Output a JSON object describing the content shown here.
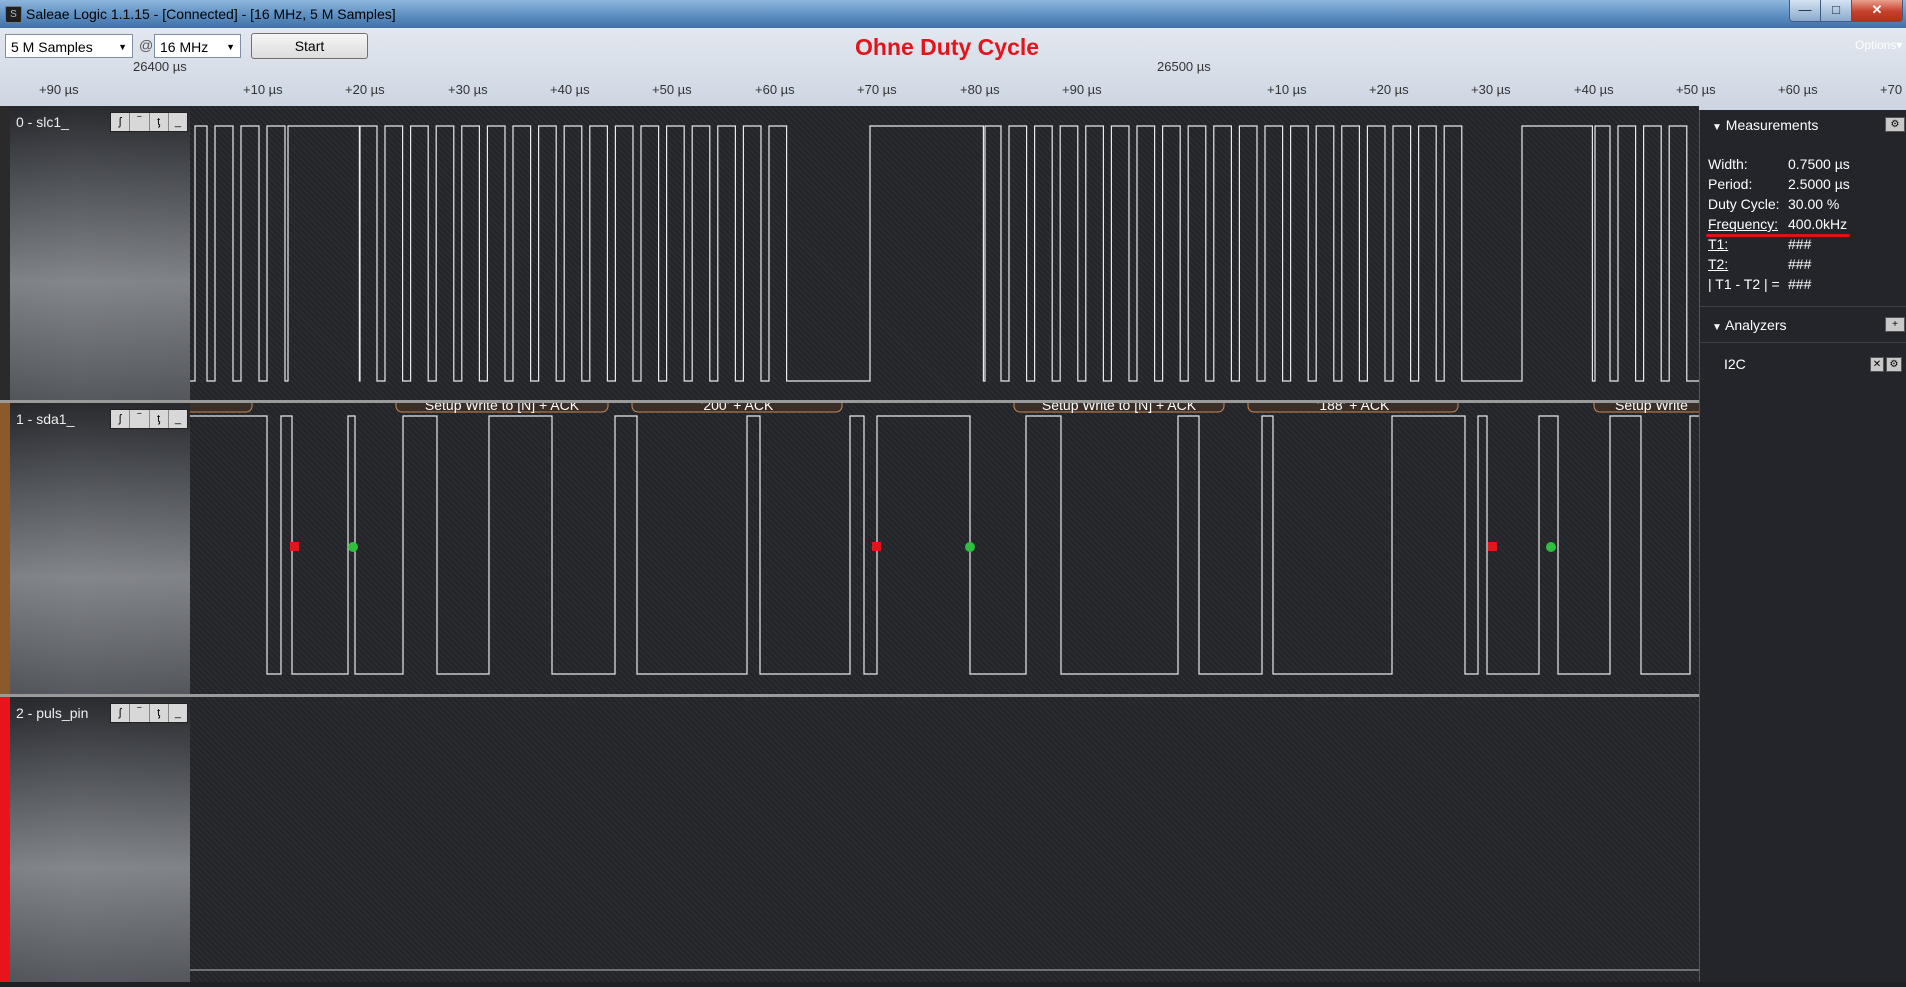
{
  "window": {
    "title": "Saleae Logic 1.1.15 - [Connected] - [16 MHz, 5 M Samples]",
    "min_glyph": "—",
    "max_glyph": "□",
    "close_glyph": "✕",
    "app_icon_glyph": "S"
  },
  "toolbar": {
    "samples_value": "5 M Samples",
    "at_sign": "@",
    "rate_value": "16 MHz",
    "start_label": "Start",
    "options_label": "Options▾",
    "heading": "Ohne Duty Cycle"
  },
  "timeline": {
    "major_left": "26400 µs",
    "major_right": "26500 µs",
    "ticks": [
      "+90 µs",
      "+10 µs",
      "+20 µs",
      "+30 µs",
      "+40 µs",
      "+50 µs",
      "+60 µs",
      "+70 µs",
      "+80 µs",
      "+90 µs",
      "+10 µs",
      "+20 µs",
      "+30 µs",
      "+40 µs",
      "+50 µs",
      "+60 µs",
      "+70"
    ]
  },
  "channels": [
    {
      "name": "0 - slc1_",
      "color": "#2a2a2a"
    },
    {
      "name": "1 - sda1_",
      "color": "#8a5a2a"
    },
    {
      "name": "2 - puls_pin",
      "color": "#e8141c"
    }
  ],
  "channel_buttons": [
    "ʃ",
    "‾",
    "ƫ",
    "_"
  ],
  "i2c_frames": [
    "Setup Write to [N] + ACK",
    "'200' + ACK",
    "Setup Write to [N] + ACK",
    "'188' + ACK",
    "Setup Write"
  ],
  "measurements": {
    "title": "Measurements",
    "rows": [
      {
        "label": "Width:",
        "value": "0.7500 µs"
      },
      {
        "label": "Period:",
        "value": "2.5000 µs"
      },
      {
        "label": "Duty Cycle:",
        "value": "30.00 %"
      },
      {
        "label": "Frequency:",
        "value": "400.0kHz"
      },
      {
        "label": "T1:",
        "value": "###"
      },
      {
        "label": "T2:",
        "value": "###"
      },
      {
        "label": "| T1 - T2 | =",
        "value": "###"
      }
    ],
    "gear_glyph": "⚙"
  },
  "analyzers": {
    "title": "Analyzers",
    "add_glyph": "+",
    "items": [
      {
        "name": "I2C",
        "close_glyph": "✕",
        "gear_glyph": "⚙"
      }
    ]
  },
  "colors": {
    "accent_red": "#e3141c",
    "start_marker": "#e3141c",
    "stop_marker": "#2fbf3f"
  }
}
